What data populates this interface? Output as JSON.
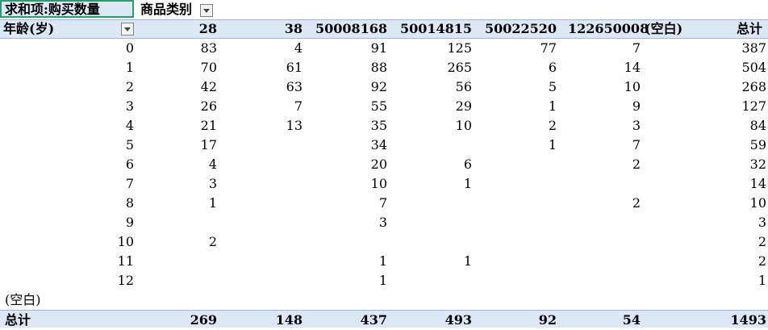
{
  "pivot": {
    "value_field": "求和项:购买数量",
    "column_field": "商品类别",
    "row_field": "年龄(岁)",
    "columns": [
      "28",
      "38",
      "50008168",
      "50014815",
      "50022520",
      "122650008",
      "(空白)",
      "总计"
    ],
    "rows": [
      {
        "age": "0",
        "cells": [
          "83",
          "4",
          "91",
          "125",
          "77",
          "7",
          "",
          "387"
        ]
      },
      {
        "age": "1",
        "cells": [
          "70",
          "61",
          "88",
          "265",
          "6",
          "14",
          "",
          "504"
        ]
      },
      {
        "age": "2",
        "cells": [
          "42",
          "63",
          "92",
          "56",
          "5",
          "10",
          "",
          "268"
        ]
      },
      {
        "age": "3",
        "cells": [
          "26",
          "7",
          "55",
          "29",
          "1",
          "9",
          "",
          "127"
        ]
      },
      {
        "age": "4",
        "cells": [
          "21",
          "13",
          "35",
          "10",
          "2",
          "3",
          "",
          "84"
        ]
      },
      {
        "age": "5",
        "cells": [
          "17",
          "",
          "34",
          "",
          "1",
          "7",
          "",
          "59"
        ]
      },
      {
        "age": "6",
        "cells": [
          "4",
          "",
          "20",
          "6",
          "",
          "2",
          "",
          "32"
        ]
      },
      {
        "age": "7",
        "cells": [
          "3",
          "",
          "10",
          "1",
          "",
          "",
          "",
          "14"
        ]
      },
      {
        "age": "8",
        "cells": [
          "1",
          "",
          "7",
          "",
          "",
          "2",
          "",
          "10"
        ]
      },
      {
        "age": "9",
        "cells": [
          "",
          "",
          "3",
          "",
          "",
          "",
          "",
          "3"
        ]
      },
      {
        "age": "10",
        "cells": [
          "2",
          "",
          "",
          "",
          "",
          "",
          "",
          "2"
        ]
      },
      {
        "age": "11",
        "cells": [
          "",
          "",
          "1",
          "1",
          "",
          "",
          "",
          "2"
        ]
      },
      {
        "age": "12",
        "cells": [
          "",
          "",
          "1",
          "",
          "",
          "",
          "",
          "1"
        ]
      }
    ],
    "blank_row_label": "(空白)",
    "grand_total_label": "总计",
    "grand_totals": [
      "269",
      "148",
      "437",
      "493",
      "92",
      "54",
      "",
      "1493"
    ]
  },
  "colors": {
    "header_bg": "#dde8f6",
    "header_border": "#9bb7db",
    "selection_border": "#21a366"
  }
}
